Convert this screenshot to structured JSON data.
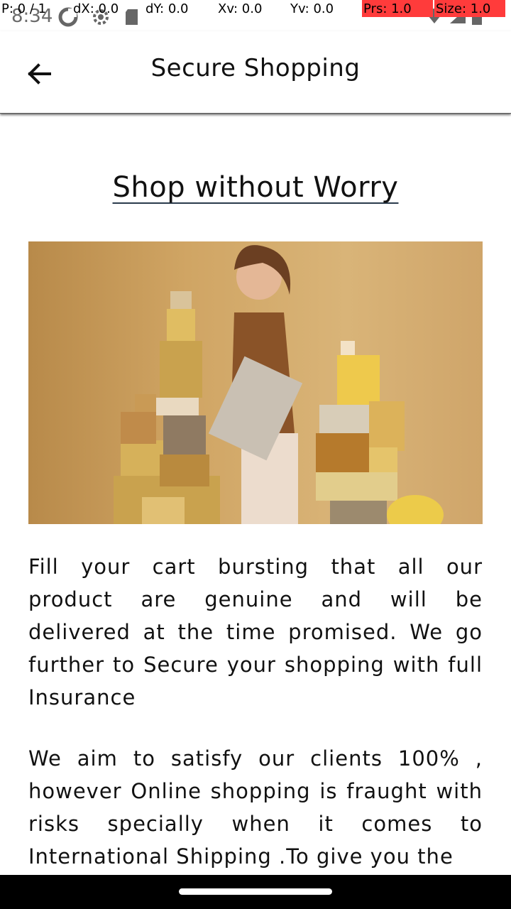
{
  "status_bar": {
    "time": "8:34",
    "icons": [
      "sync-icon",
      "settings-gear-icon",
      "sd-card-icon",
      "wifi-icon",
      "signal-icon",
      "battery-icon"
    ]
  },
  "debug_overlay": {
    "pointer": "P: 0 / 1",
    "dx": "dX: 0.0",
    "dy": "dY: 0.0",
    "xv": "Xv: 0.0",
    "yv": "Yv: 0.0",
    "prs": "Prs: 1.0",
    "size": "Size: 1.0",
    "highlight_color": "#ff3b3b"
  },
  "app_bar": {
    "title": "Secure Shopping",
    "back_icon": "arrow-left-icon"
  },
  "content": {
    "heading": "Shop without Worry",
    "hero_image_alt": "woman-with-gift-boxes-image",
    "paragraphs": [
      "Fill your cart bursting that all our product are genuine and will be delivered at the time promised. We go further to Secure your shopping with full Insurance",
      "We aim to satisfy our clients 100% , however Online shopping is fraught with risks specially when it comes to International Shipping .To give you the"
    ]
  },
  "nav_bar": {
    "handle": "gesture-handle"
  }
}
